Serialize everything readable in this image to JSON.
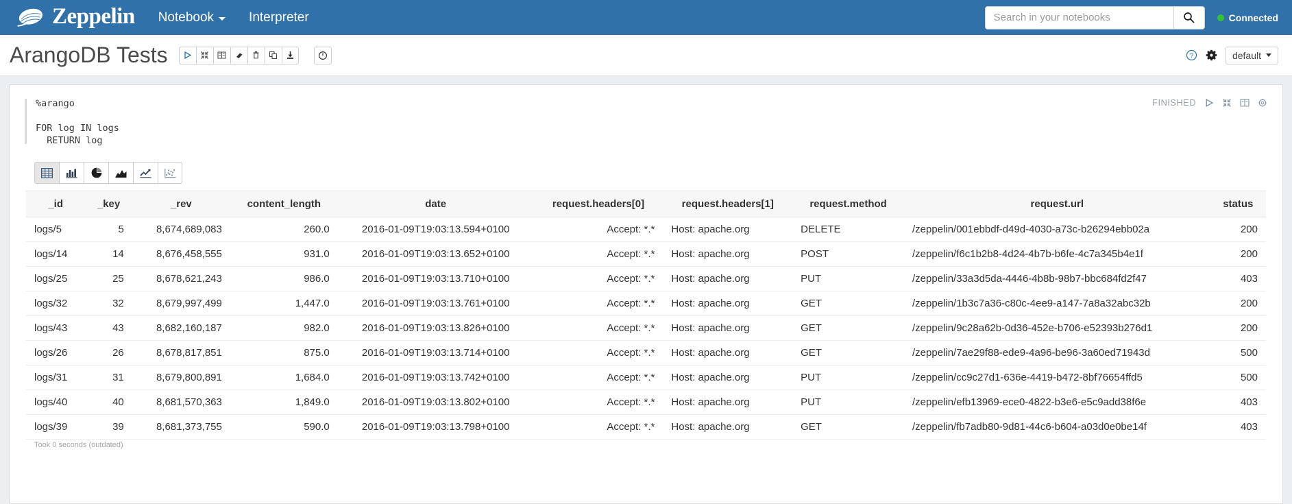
{
  "navbar": {
    "brand": "Zeppelin",
    "brand_logo_icon": "zeppelin-airship-logo",
    "links": [
      {
        "label": "Notebook",
        "has_caret": true
      },
      {
        "label": "Interpreter",
        "has_caret": false
      }
    ],
    "search": {
      "placeholder": "Search in your notebooks",
      "value": "",
      "icon": "search-icon"
    },
    "connection": {
      "label": "Connected",
      "dot_color": "#36c236"
    }
  },
  "notebook_header": {
    "title": "ArangoDB Tests",
    "toolbar": [
      {
        "icon": "run-all-paragraphs-icon",
        "title": "Run all paragraphs"
      },
      {
        "icon": "collapse-all-icon",
        "title": "Show/hide all code"
      },
      {
        "icon": "book-icon",
        "title": "Show/hide all output"
      },
      {
        "icon": "eraser-icon",
        "title": "Clear all output"
      },
      {
        "icon": "trash-icon",
        "title": "Remove notebook"
      },
      {
        "icon": "clone-icon",
        "title": "Clone notebook"
      },
      {
        "icon": "export-icon",
        "title": "Export notebook"
      }
    ],
    "scheduler": {
      "icon": "clock-icon",
      "title": "Run scheduler"
    },
    "help": {
      "icon": "help-circle-icon"
    },
    "settings": {
      "icon": "gear-icon"
    },
    "permissions_select": {
      "value": "default"
    }
  },
  "paragraph": {
    "code": "%arango\n\nFOR log IN logs\n  RETURN log",
    "status": "FINISHED",
    "status_icons": [
      {
        "icon": "run-paragraph-icon"
      },
      {
        "icon": "collapse-paragraph-icon"
      },
      {
        "icon": "book-icon"
      },
      {
        "icon": "gear-icon"
      }
    ],
    "took": "Took 0 seconds (outdated)"
  },
  "visualization_tabs": [
    {
      "icon": "table-icon",
      "active": true
    },
    {
      "icon": "bar-chart-icon",
      "active": false
    },
    {
      "icon": "pie-chart-icon",
      "active": false
    },
    {
      "icon": "area-chart-icon",
      "active": false
    },
    {
      "icon": "line-chart-icon",
      "active": false
    },
    {
      "icon": "scatter-chart-icon",
      "active": false
    }
  ],
  "result_table": {
    "columns": [
      {
        "label": "_id",
        "align": "c-left"
      },
      {
        "label": "_key",
        "align": "c-right"
      },
      {
        "label": "_rev",
        "align": "c-right"
      },
      {
        "label": "content_length",
        "align": "c-right"
      },
      {
        "label": "date",
        "align": "c-center"
      },
      {
        "label": "request.headers[0]",
        "align": "c-right"
      },
      {
        "label": "request.headers[1]",
        "align": "c-left"
      },
      {
        "label": "request.method",
        "align": "c-left"
      },
      {
        "label": "request.url",
        "align": "c-left"
      },
      {
        "label": "status",
        "align": "c-right"
      }
    ],
    "rows": [
      [
        "logs/5",
        "5",
        "8,674,689,083",
        "260.0",
        "2016-01-09T19:03:13.594+0100",
        "Accept: *.*",
        "Host: apache.org",
        "DELETE",
        "/zeppelin/001ebbdf-d49d-4030-a73c-b26294ebb02a",
        "200"
      ],
      [
        "logs/14",
        "14",
        "8,676,458,555",
        "931.0",
        "2016-01-09T19:03:13.652+0100",
        "Accept: *.*",
        "Host: apache.org",
        "POST",
        "/zeppelin/f6c1b2b8-4d24-4b7b-b6fe-4c7a345b4e1f",
        "200"
      ],
      [
        "logs/25",
        "25",
        "8,678,621,243",
        "986.0",
        "2016-01-09T19:03:13.710+0100",
        "Accept: *.*",
        "Host: apache.org",
        "PUT",
        "/zeppelin/33a3d5da-4446-4b8b-98b7-bbc684fd2f47",
        "403"
      ],
      [
        "logs/32",
        "32",
        "8,679,997,499",
        "1,447.0",
        "2016-01-09T19:03:13.761+0100",
        "Accept: *.*",
        "Host: apache.org",
        "GET",
        "/zeppelin/1b3c7a36-c80c-4ee9-a147-7a8a32abc32b",
        "200"
      ],
      [
        "logs/43",
        "43",
        "8,682,160,187",
        "982.0",
        "2016-01-09T19:03:13.826+0100",
        "Accept: *.*",
        "Host: apache.org",
        "GET",
        "/zeppelin/9c28a62b-0d36-452e-b706-e52393b276d1",
        "200"
      ],
      [
        "logs/26",
        "26",
        "8,678,817,851",
        "875.0",
        "2016-01-09T19:03:13.714+0100",
        "Accept: *.*",
        "Host: apache.org",
        "GET",
        "/zeppelin/7ae29f88-ede9-4a96-be96-3a60ed71943d",
        "500"
      ],
      [
        "logs/31",
        "31",
        "8,679,800,891",
        "1,684.0",
        "2016-01-09T19:03:13.742+0100",
        "Accept: *.*",
        "Host: apache.org",
        "PUT",
        "/zeppelin/cc9c27d1-636e-4419-b472-8bf76654ffd5",
        "500"
      ],
      [
        "logs/40",
        "40",
        "8,681,570,363",
        "1,849.0",
        "2016-01-09T19:03:13.802+0100",
        "Accept: *.*",
        "Host: apache.org",
        "PUT",
        "/zeppelin/efb13969-ece0-4822-b3e6-e5c9add38f6e",
        "403"
      ],
      [
        "logs/39",
        "39",
        "8,681,373,755",
        "590.0",
        "2016-01-09T19:03:13.798+0100",
        "Accept: *.*",
        "Host: apache.org",
        "GET",
        "/zeppelin/fb7adb80-9d81-44c6-b604-a03d0e0be14f",
        "403"
      ]
    ]
  },
  "colors": {
    "navbar_bg": "#3071a9",
    "body_bg": "#eceff1",
    "accent": "#3071a9",
    "connected": "#36c236"
  }
}
